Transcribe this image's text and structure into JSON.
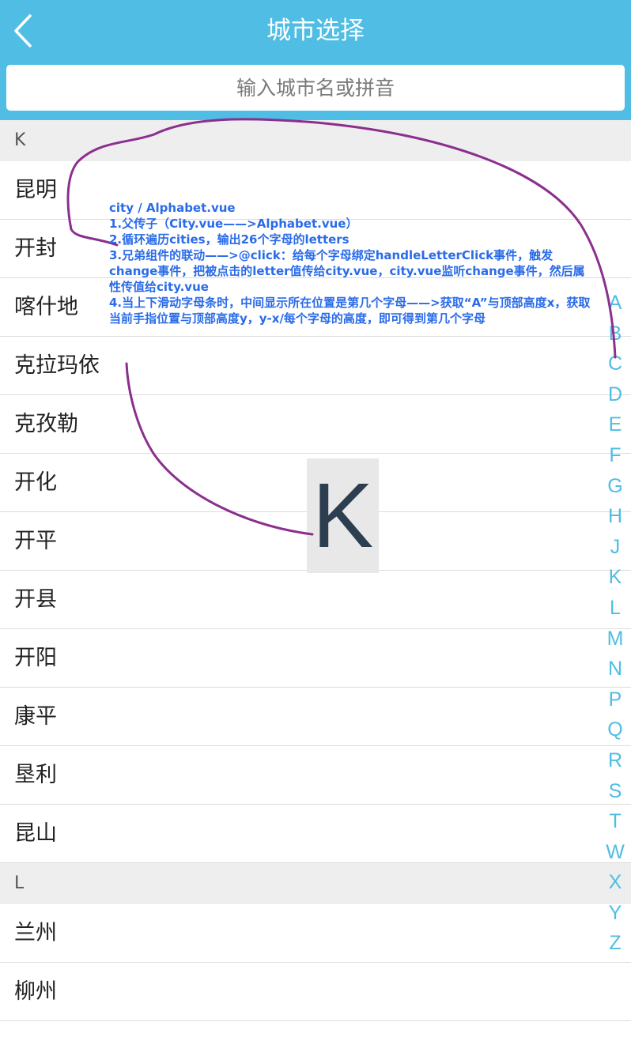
{
  "header": {
    "title": "城市选择",
    "back_icon": "chevron-left-icon"
  },
  "search": {
    "placeholder": "输入城市名或拼音",
    "value": ""
  },
  "groups": [
    {
      "letter": "K",
      "cities": [
        "昆明",
        "开封",
        "喀什地",
        "克拉玛依",
        "克孜勒",
        "开化",
        "开平",
        "开县",
        "开阳",
        "康平",
        "垦利",
        "昆山"
      ]
    },
    {
      "letter": "L",
      "cities": [
        "兰州",
        "柳州"
      ]
    }
  ],
  "alphabet": [
    "A",
    "B",
    "C",
    "D",
    "E",
    "F",
    "G",
    "H",
    "J",
    "K",
    "L",
    "M",
    "N",
    "P",
    "Q",
    "R",
    "S",
    "T",
    "W",
    "X",
    "Y",
    "Z"
  ],
  "current_letter": "K",
  "annotation": {
    "lines": [
      "city / Alphabet.vue",
      "1.父传子（City.vue——>Alphabet.vue）",
      "2.循环遍历cities，输出26个字母的letters",
      "3.兄弟组件的联动——>@click：给每个字母绑定handleLetterClick事件，触发change事件，把被点击的letter值传给city.vue，city.vue监听change事件，然后属性传值给city.vue",
      "4.当上下滑动字母条时，中间显示所在位置是第几个字母——>获取“A”与顶部高度x，获取当前手指位置与顶部高度y，y-x/每个字母的高度，即可得到第几个字母"
    ],
    "text_color": "#2a6be8",
    "ink_color": "#8b2f8f"
  },
  "colors": {
    "accent": "#4fbde4",
    "group_bg": "#eeeeee",
    "divider": "#dcdcdc"
  }
}
